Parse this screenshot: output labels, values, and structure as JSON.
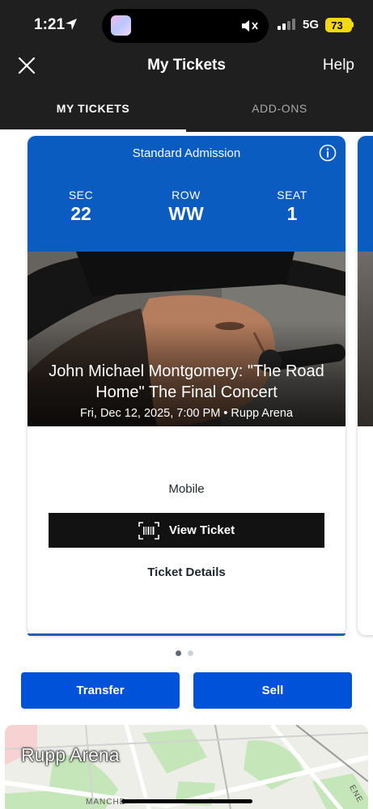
{
  "status_bar": {
    "time": "1:21",
    "network": "5G",
    "battery": "73"
  },
  "header": {
    "title": "My Tickets",
    "help_label": "Help"
  },
  "tabs": [
    {
      "label": "MY TICKETS",
      "active": true
    },
    {
      "label": "ADD-ONS",
      "active": false
    }
  ],
  "ticket": {
    "admission_type": "Standard Admission",
    "section_label": "SEC",
    "section": "22",
    "row_label": "ROW",
    "row": "WW",
    "seat_label": "SEAT",
    "seat": "1",
    "event_title": "John Michael Montgomery: \"The Road Home\" The Final Concert",
    "event_meta": "Fri, Dec 12, 2025, 7:00 PM • Rupp Arena",
    "delivery": "Mobile",
    "view_ticket_label": "View Ticket",
    "ticket_details_label": "Ticket Details"
  },
  "pagination": {
    "current": 1,
    "total": 2
  },
  "actions": {
    "transfer_label": "Transfer",
    "sell_label": "Sell"
  },
  "map": {
    "venue_name": "Rupp Arena",
    "street_1": "MANCHE",
    "street_2": "ENE"
  },
  "colors": {
    "brand_blue": "#0a5cc0",
    "button_blue": "#0052d9",
    "header_dark": "#1f1f1f",
    "battery_yellow": "#f5d90a"
  }
}
